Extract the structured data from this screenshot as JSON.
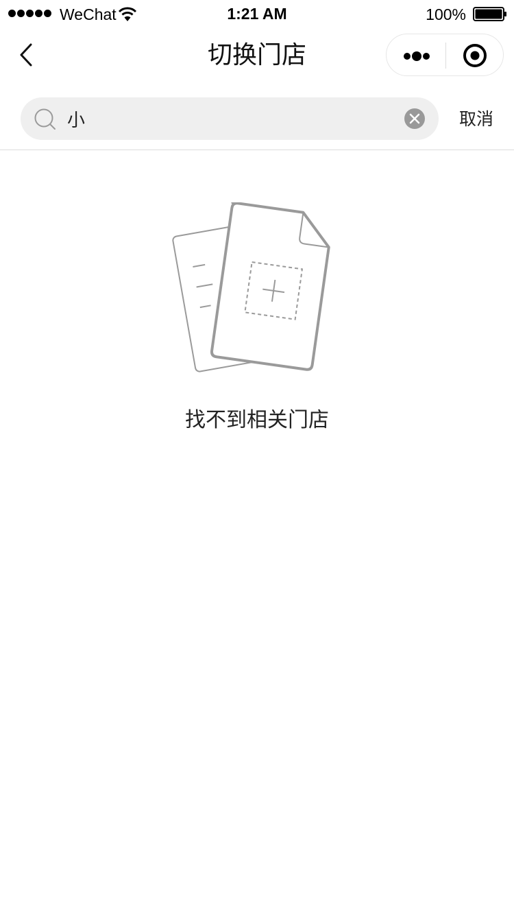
{
  "status_bar": {
    "carrier": "WeChat",
    "time": "1:21 AM",
    "battery_percent": "100%",
    "signal_bars": 5,
    "icons": [
      "signal-dots-icon",
      "wifi-icon",
      "battery-icon"
    ]
  },
  "nav": {
    "title": "切换门店",
    "icons": [
      "back-arrow-icon",
      "more-dots-icon",
      "target-close-icon"
    ]
  },
  "search": {
    "value": "小",
    "cancel_label": "取消",
    "icons": [
      "search-icon",
      "clear-icon"
    ]
  },
  "empty_state": {
    "message": "找不到相关门店",
    "icon": "empty-documents-icon"
  },
  "colors": {
    "background": "#ffffff",
    "search_bg": "#efefef",
    "icon_gray": "#999999",
    "text_dark": "#222222"
  }
}
